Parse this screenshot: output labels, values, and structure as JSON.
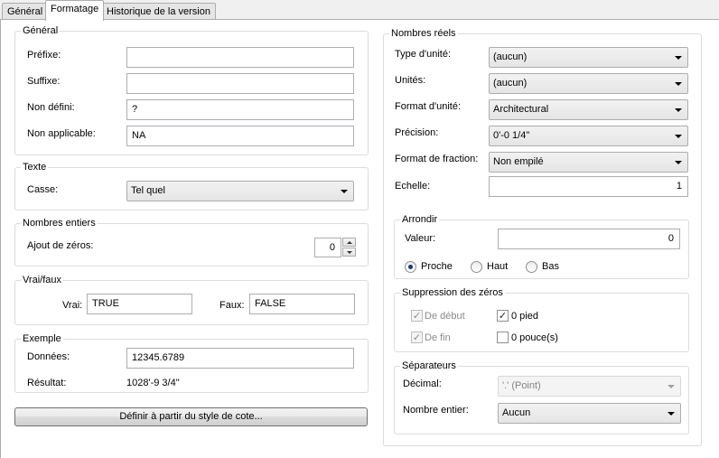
{
  "tabs": [
    "Général",
    "Formatage",
    "Historique de la version"
  ],
  "general": {
    "legend": "Général",
    "prefix_label": "Préfixe:",
    "prefix_value": "",
    "suffix_label": "Suffixe:",
    "suffix_value": "",
    "undefined_label": "Non défini:",
    "undefined_value": "?",
    "na_label": "Non applicable:",
    "na_value": "NA"
  },
  "text": {
    "legend": "Texte",
    "case_label": "Casse:",
    "case_value": "Tel quel"
  },
  "integers": {
    "legend": "Nombres entiers",
    "padding_label": "Ajout de zéros:",
    "padding_value": "0"
  },
  "truefalse": {
    "legend": "Vrai/faux",
    "true_label": "Vrai:",
    "true_value": "TRUE",
    "false_label": "Faux:",
    "false_value": "FALSE"
  },
  "example": {
    "legend": "Exemple",
    "data_label": "Données:",
    "data_value": "12345.6789",
    "result_label": "Résultat:",
    "result_value": "1028'-9 3/4\""
  },
  "dimstyle_button": "Définir à partir du style de cote...",
  "reals": {
    "legend": "Nombres réels",
    "unit_type_label": "Type d'unité:",
    "unit_type_value": "(aucun)",
    "units_label": "Unités:",
    "units_value": "(aucun)",
    "unit_format_label": "Format d'unité:",
    "unit_format_value": "Architectural",
    "precision_label": "Précision:",
    "precision_value": "0'-0 1/4\"",
    "fraction_label": "Format de fraction:",
    "fraction_value": "Non empilé",
    "scale_label": "Echelle:",
    "scale_value": "1"
  },
  "rounding": {
    "legend": "Arrondir",
    "value_label": "Valeur:",
    "value": "0",
    "nearest": "Proche",
    "up": "Haut",
    "down": "Bas",
    "selected": "Proche"
  },
  "zeros": {
    "legend": "Suppression des zéros",
    "leading": "De début",
    "trailing": "De fin",
    "feet": "0 pied",
    "inches": "0 pouce(s)",
    "leading_checked": true,
    "trailing_checked": true,
    "feet_checked": true,
    "inches_checked": false
  },
  "separators": {
    "legend": "Séparateurs",
    "decimal_label": "Décimal:",
    "decimal_value": "'.' (Point)",
    "integer_label": "Nombre entier:",
    "integer_value": "Aucun"
  }
}
